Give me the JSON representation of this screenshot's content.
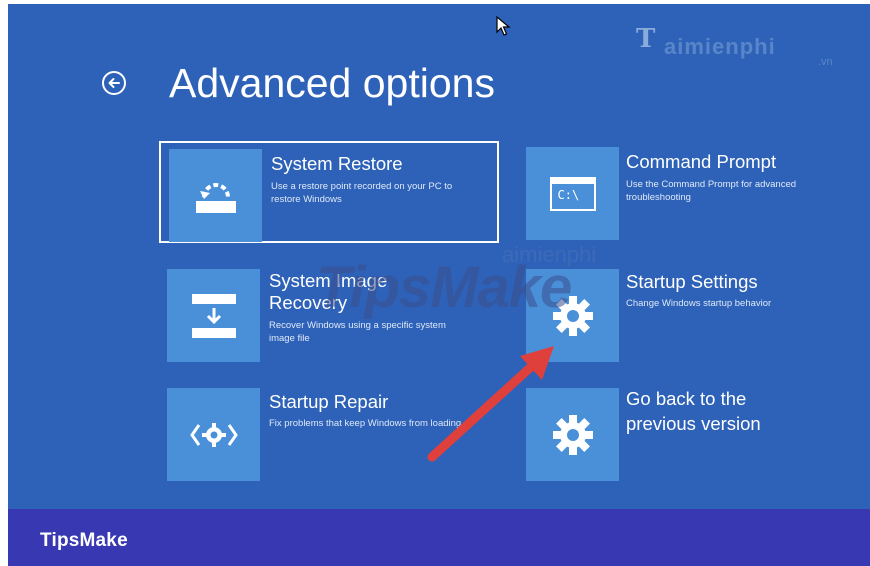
{
  "header": {
    "back_icon": "back-arrow-circle-icon",
    "title": "Advanced options"
  },
  "tiles": [
    {
      "title": "System Restore",
      "desc": "Use a restore point recorded on your PC to restore Windows",
      "icon": "system-restore-icon",
      "selected": true
    },
    {
      "title": "Command Prompt",
      "desc": "Use the Command Prompt for advanced troubleshooting",
      "icon": "command-prompt-icon",
      "icon_text": "C:\\"
    },
    {
      "title_line1": "System Image",
      "title_line2": "Recovery",
      "desc": "Recover Windows using a specific system image file",
      "icon": "system-image-icon"
    },
    {
      "title": "Startup Settings",
      "desc": "Change Windows startup behavior",
      "icon": "gear-icon"
    },
    {
      "title": "Startup Repair",
      "desc": "Fix problems that keep Windows from loading",
      "icon": "startup-repair-icon"
    },
    {
      "title_line1": "Go back to the",
      "title_line2": "previous version",
      "icon": "gear-icon"
    }
  ],
  "watermarks": {
    "top_right_letter": "T",
    "top_right_name": "aimienphi",
    "top_right_tld": ".vn",
    "center_brand": "TipsMake",
    "center_faint": "aimienphi"
  },
  "footer": {
    "label": "TipsMake"
  },
  "colors": {
    "screen_bg": "#2d62b8",
    "tile_icon_bg": "#4a90d9",
    "footer_bg": "#3838b2",
    "annotation_arrow": "#e0403c"
  }
}
